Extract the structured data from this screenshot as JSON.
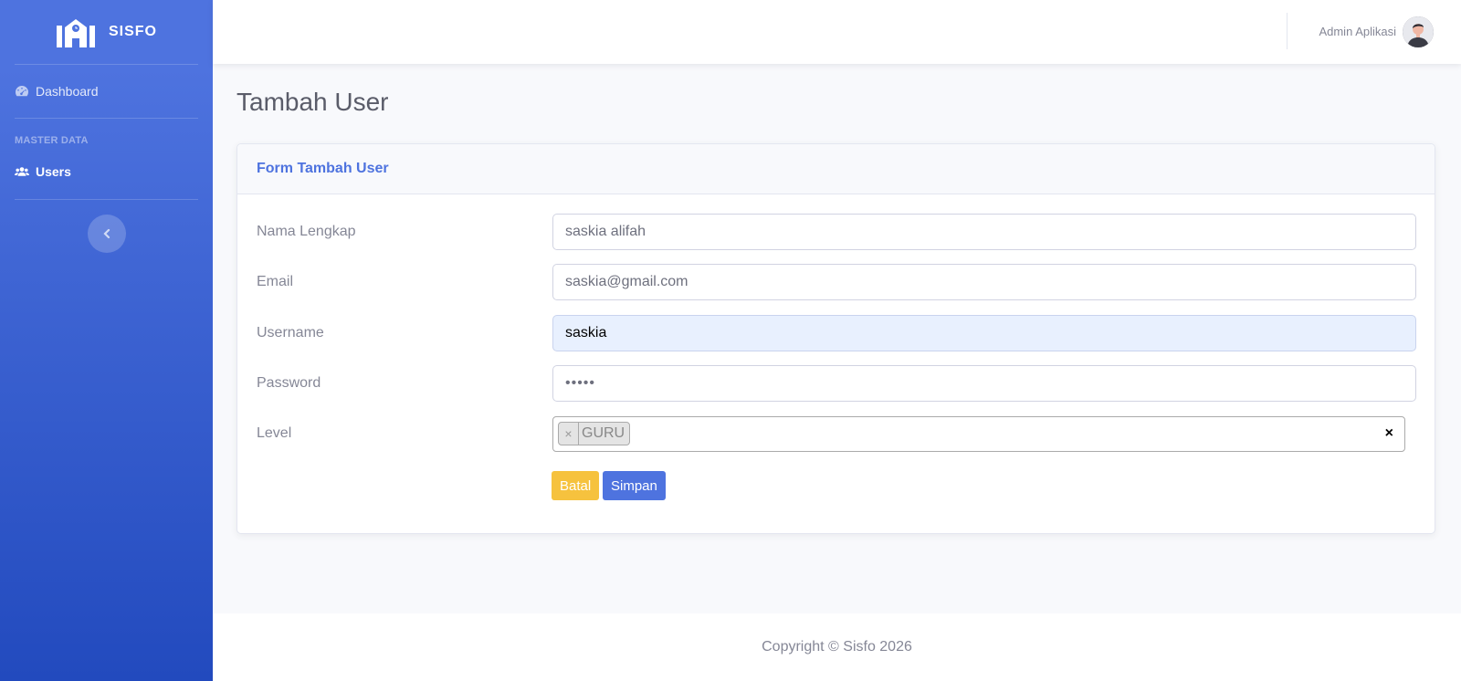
{
  "sidebar": {
    "brand": "SISFO",
    "brand_icon": "school-icon",
    "dashboard": {
      "label": "Dashboard",
      "icon": "tachometer-icon"
    },
    "heading": "MASTER DATA",
    "users": {
      "label": "Users",
      "icon": "users-icon"
    },
    "toggle_icon": "chevron-left-icon"
  },
  "topbar": {
    "user_name": "Admin Aplikasi"
  },
  "main": {
    "page_title": "Tambah User",
    "card_title": "Form Tambah User",
    "fields": {
      "nama": {
        "label": "Nama Lengkap",
        "value": "saskia alifah"
      },
      "email": {
        "label": "Email",
        "value": "saskia@gmail.com"
      },
      "username": {
        "label": "Username",
        "value": "saskia"
      },
      "password": {
        "label": "Password",
        "value": "•••••"
      },
      "level": {
        "label": "Level",
        "selected": "GURU",
        "remove_glyph": "×",
        "clear_glyph": "×"
      }
    },
    "buttons": {
      "cancel": "Batal",
      "save": "Simpan"
    }
  },
  "footer": {
    "copyright": "Copyright © Sisfo 2026"
  },
  "colors": {
    "primary": "#4e73df",
    "warning": "#f6c23e",
    "sidebar_bottom": "#224abe"
  }
}
